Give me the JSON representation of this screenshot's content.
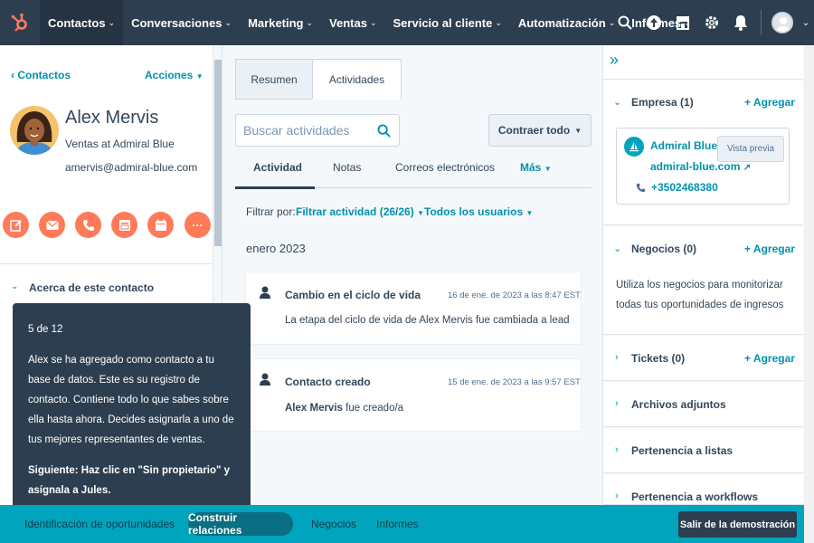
{
  "nav": {
    "items": [
      {
        "label": "Contactos",
        "active": true
      },
      {
        "label": "Conversaciones"
      },
      {
        "label": "Marketing"
      },
      {
        "label": "Ventas"
      },
      {
        "label": "Servicio al cliente"
      },
      {
        "label": "Automatización"
      },
      {
        "label": "Informes"
      }
    ],
    "chevron": "⌄"
  },
  "contact": {
    "back_label": "Contactos",
    "back_arrow": "‹",
    "actions_label": "Acciones",
    "name": "Alex Mervis",
    "title": "Ventas at Admiral Blue",
    "email": "amervis@admiral-blue.com",
    "about_label": "Acerca de este contacto"
  },
  "tabs": {
    "summary": "Resumen",
    "activities": "Actividades"
  },
  "search": {
    "placeholder": "Buscar actividades"
  },
  "collapse_label": "Contraer todo",
  "subtabs": {
    "activity": "Actividad",
    "notes": "Notas",
    "emails": "Correos electrónicos",
    "more": "Más"
  },
  "filter": {
    "label": "Filtrar por:",
    "activity": "Filtrar actividad (26/26)",
    "users": "Todos los usuarios"
  },
  "month": "enero 2023",
  "activities": [
    {
      "title": "Cambio en el ciclo de vida",
      "date": "16 de ene. de 2023 a las 8:47 EST",
      "body": "La etapa del ciclo de vida de Alex Mervis fue cambiada a lead"
    },
    {
      "title": "Contacto creado",
      "date": "15 de ene. de 2023 a las 9:57 EST",
      "body_bold": "Alex Mervis",
      "body_rest": " fue creado/a"
    }
  ],
  "right": {
    "company_header": "Empresa (1)",
    "add_label": "+ Agregar",
    "company_name": "Admiral Blue",
    "company_domain": "admiral-blue.com",
    "company_phone": "+3502468380",
    "preview_label": "Vista previa",
    "deals_header": "Negocios (0)",
    "deals_text": "Utiliza los negocios para monitorizar todas tus oportunidades de ingresos",
    "tickets_header": "Tickets (0)",
    "attachments_header": "Archivos adjuntos",
    "lists_header": "Pertenencia a listas",
    "workflows_header": "Pertenencia a workflows"
  },
  "tooltip": {
    "step": "5 de 12",
    "body": "Alex se ha agregado como contacto a tu base de datos. Este es su registro de contacto. Contiene todo lo que sabes sobre ella hasta ahora. Decides asignarla a uno de tus mejores representantes de ventas.",
    "next": "Siguiente: Haz clic en \"Sin propietario\" y asígnala a Jules."
  },
  "bottom": {
    "items": [
      "Identificación de oportunidades",
      "Construir relaciones",
      "Negocios",
      "Informes"
    ],
    "exit_label": "Salir de la demostración"
  },
  "colors": {
    "nav_bg": "#2d3e50",
    "accent_orange": "#ff7a59",
    "link_teal": "#0091ae",
    "bottom_bar": "#00a4bd"
  }
}
